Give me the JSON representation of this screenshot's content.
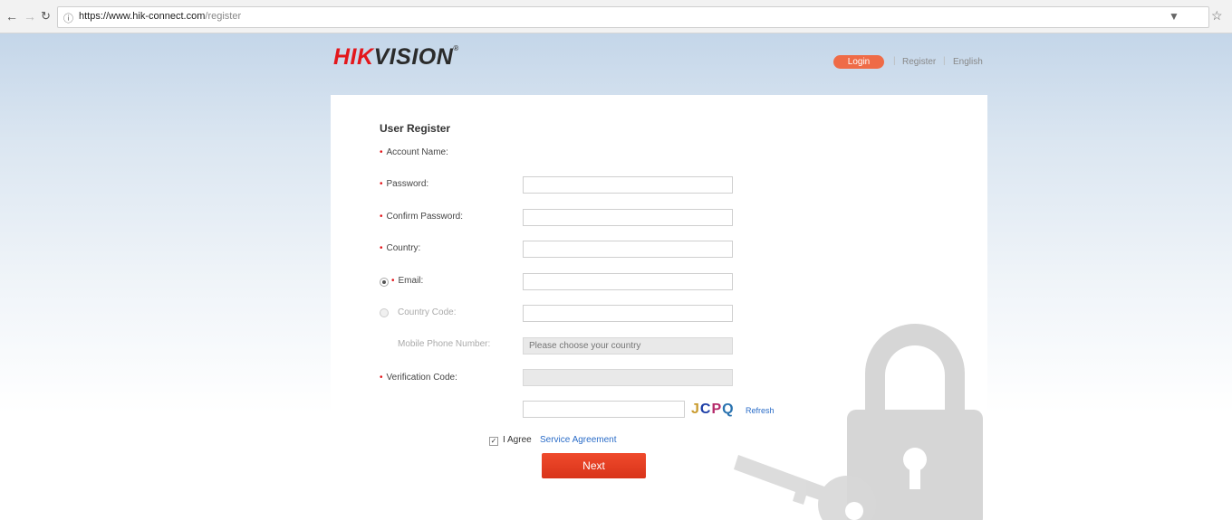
{
  "browser": {
    "url_host": "https://www.hik-connect.com",
    "url_path": "/register",
    "back_icon": "arrow-left",
    "forward_icon": "arrow-right",
    "reload_icon": "reload",
    "info_icon": "info-circle",
    "star_icon": "star"
  },
  "header": {
    "logo_hik": "HIK",
    "logo_vision": "VISION",
    "logo_mark": "®",
    "login_label": "Login",
    "register_label": "Register",
    "language_label": "English"
  },
  "form": {
    "title": "User Register",
    "required_mark": "•",
    "account_name_label": "Account Name:",
    "password_label": "Password:",
    "confirm_password_label": "Confirm Password:",
    "country_label": "Country:",
    "email_label": "Email:",
    "country_code_label": "Country Code:",
    "country_code_placeholder": "Please choose your country",
    "mobile_label": "Mobile Phone Number:",
    "verification_label": "Verification Code:",
    "captcha": [
      "J",
      "C",
      "P",
      "Q"
    ],
    "refresh_label": "Refresh",
    "agree_label": "I Agree",
    "agreement_link": "Service Agreement",
    "agree_checked": true,
    "email_selected": true,
    "next_label": "Next"
  },
  "colors": {
    "brand_red": "#e3171c",
    "login_orange": "#ef6b47",
    "next_red": "#e4411f",
    "link_blue": "#2a6cc8"
  }
}
